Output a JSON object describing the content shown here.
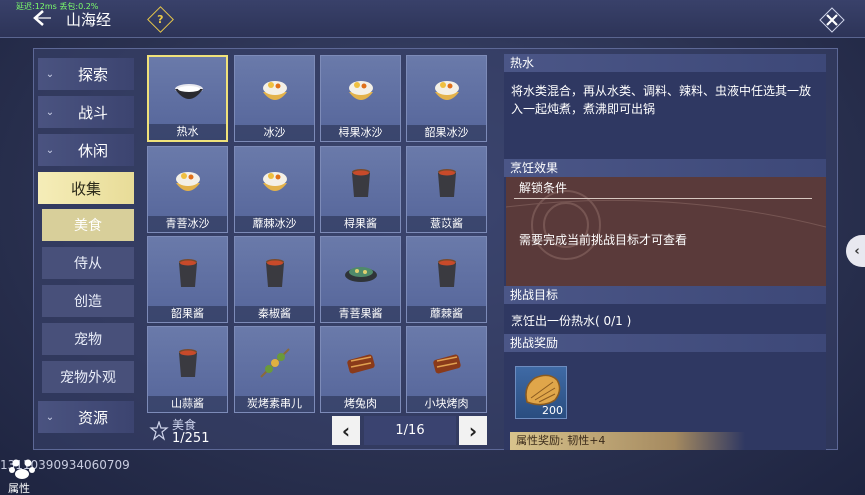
{
  "header": {
    "net_info": "延迟:12ms 丢包:0.2%",
    "title": "山海经"
  },
  "sidebar": {
    "categories": [
      {
        "label": "探索"
      },
      {
        "label": "战斗"
      },
      {
        "label": "休闲"
      },
      {
        "label": "收集"
      },
      {
        "label": "资源"
      }
    ],
    "subitems": [
      {
        "label": "美食"
      },
      {
        "label": "侍从"
      },
      {
        "label": "创造"
      },
      {
        "label": "宠物"
      },
      {
        "label": "宠物外观"
      }
    ]
  },
  "grid": {
    "items": [
      {
        "name": "热水",
        "icon": "bowl-icon"
      },
      {
        "name": "冰沙",
        "icon": "shaved-ice-icon"
      },
      {
        "name": "桪果冰沙",
        "icon": "shaved-ice-icon"
      },
      {
        "name": "韶果冰沙",
        "icon": "shaved-ice-icon"
      },
      {
        "name": "青菩冰沙",
        "icon": "shaved-ice-icon"
      },
      {
        "name": "蘼棘冰沙",
        "icon": "shaved-ice-icon"
      },
      {
        "name": "桪果酱",
        "icon": "jam-jar-icon"
      },
      {
        "name": "薏苡酱",
        "icon": "jam-jar-icon"
      },
      {
        "name": "韶果酱",
        "icon": "jam-jar-icon"
      },
      {
        "name": "秦椒酱",
        "icon": "jam-jar-icon"
      },
      {
        "name": "青菩果酱",
        "icon": "dish-icon"
      },
      {
        "name": "蘼棘酱",
        "icon": "jam-jar-icon"
      },
      {
        "name": "山蒜酱",
        "icon": "jam-jar-icon"
      },
      {
        "name": "炭烤素串儿",
        "icon": "skewer-icon"
      },
      {
        "name": "烤兔肉",
        "icon": "roast-meat-icon"
      },
      {
        "name": "小块烤肉",
        "icon": "roast-meat-icon"
      }
    ],
    "count_label": "美食",
    "count_value": "1/251",
    "page": "1/16"
  },
  "detail": {
    "name": "热水",
    "description": "将水类混合，再从水类、调料、辣料、虫液中任选其一放入一起炖煮，煮沸即可出锅",
    "effect_header": "烹饪效果",
    "unlock_title": "解锁条件",
    "unlock_text": "需要完成当前挑战目标才可查看",
    "goal_header": "挑战目标",
    "goal_text": "烹饪出一份热水( 0/1 )",
    "reward_header": "挑战奖励",
    "reward_qty": "200",
    "attr_reward": "属性奖励: 韧性+4"
  },
  "footer": {
    "uid": "1311039093406070​9",
    "attr_label": "属性"
  },
  "colors": {
    "accent_gold": "#f0e27a",
    "active_tab": "#e8dc98",
    "unlock_box": "#5a3a3a"
  }
}
